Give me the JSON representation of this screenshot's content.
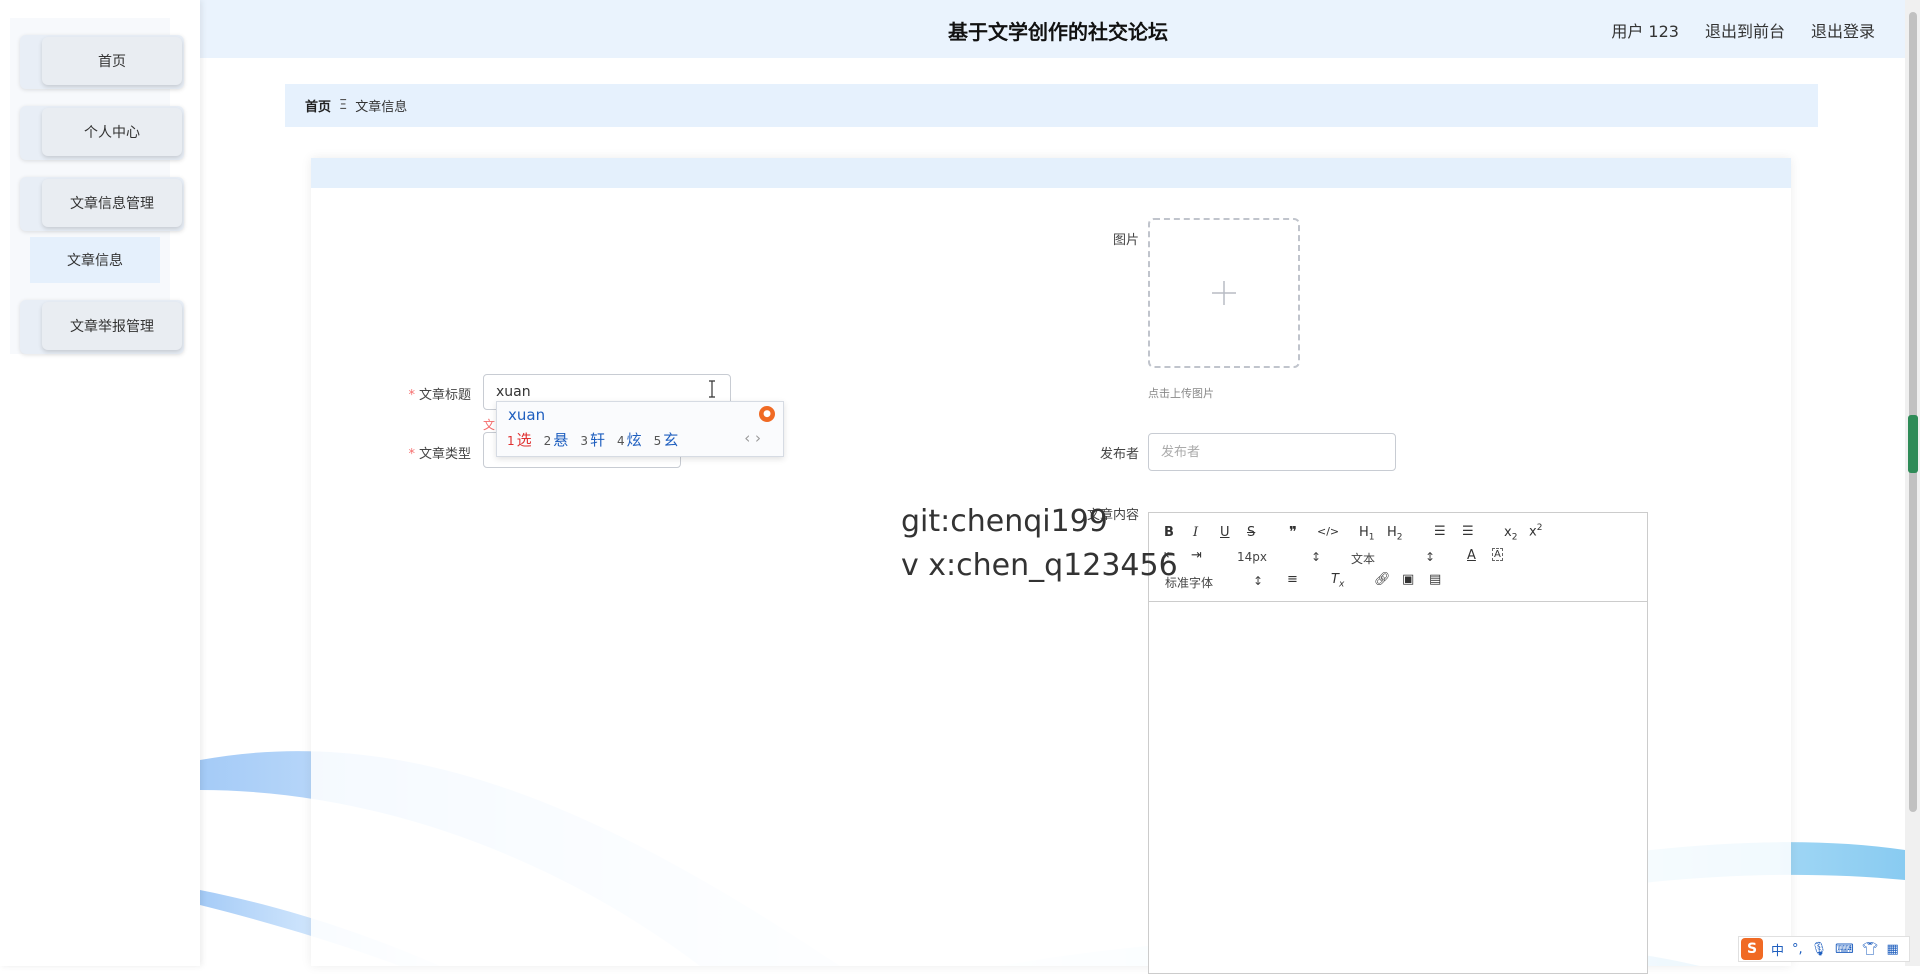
{
  "header": {
    "title": "基于文学创作的社交论坛",
    "user": "用户 123",
    "front_link": "退出到前台",
    "logout_link": "退出登录"
  },
  "sidebar": {
    "items": [
      {
        "label": "首页"
      },
      {
        "label": "个人中心"
      },
      {
        "label": "文章信息管理"
      },
      {
        "label": "文章举报管理"
      }
    ],
    "submenu": {
      "label": "文章信息"
    }
  },
  "breadcrumb": {
    "home": "首页",
    "separator": "Ξ",
    "current": "文章信息"
  },
  "form": {
    "image_label": "图片",
    "upload_hint": "点击上传图片",
    "title_label": "文章标题",
    "title_value": "xuan",
    "title_error": "文",
    "type_label": "文章类型",
    "publisher_label": "发布者",
    "publisher_placeholder": "发布者",
    "content_label": "文章内容"
  },
  "ime": {
    "pinyin": "xuan",
    "candidates": [
      {
        "num": "1",
        "char": "选"
      },
      {
        "num": "2",
        "char": "悬"
      },
      {
        "num": "3",
        "char": "轩"
      },
      {
        "num": "4",
        "char": "炫"
      },
      {
        "num": "5",
        "char": "玄"
      }
    ],
    "arrows": "‹ ›"
  },
  "editor": {
    "font_size": "14px",
    "block_type": "文本",
    "font_family": "标准字体"
  },
  "watermark": {
    "line1": "git:chenqi199",
    "line2": "v x:chen_q123456"
  },
  "ime_bar": {
    "logo": "S",
    "mode": "中",
    "punct": "°,"
  }
}
